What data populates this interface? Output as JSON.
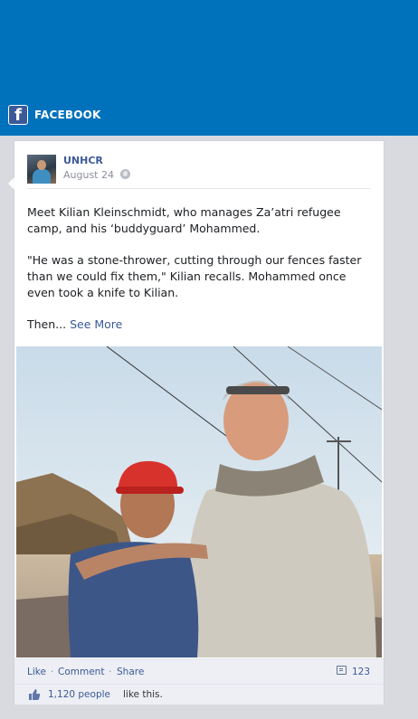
{
  "header": {
    "platform_label": "FACEBOOK",
    "icon": "facebook-logo-icon",
    "color": "#0071bb"
  },
  "post": {
    "author": "UNHCR",
    "date": "August 24",
    "privacy_icon": "globe-icon",
    "paragraph1": "Meet Kilian Kleinschmidt, who manages Za’atri refugee camp, and his ‘buddyguard’ Mohammed.",
    "paragraph2": "\"He was a stone-thrower, cutting through our fences faster than we could fix them,\" Kilian recalls. Mohammed once even took a knife to Kilian.",
    "then_text": "Then...",
    "see_more": "See More",
    "photo_icon": "post-photo"
  },
  "actions": {
    "like": "Like",
    "comment": "Comment",
    "share": "Share",
    "separator": "·",
    "comment_count": "123",
    "comment_icon": "comment-icon"
  },
  "likes": {
    "count": "1,120 people",
    "suffix": "like this.",
    "icon": "thumbs-up-icon"
  }
}
